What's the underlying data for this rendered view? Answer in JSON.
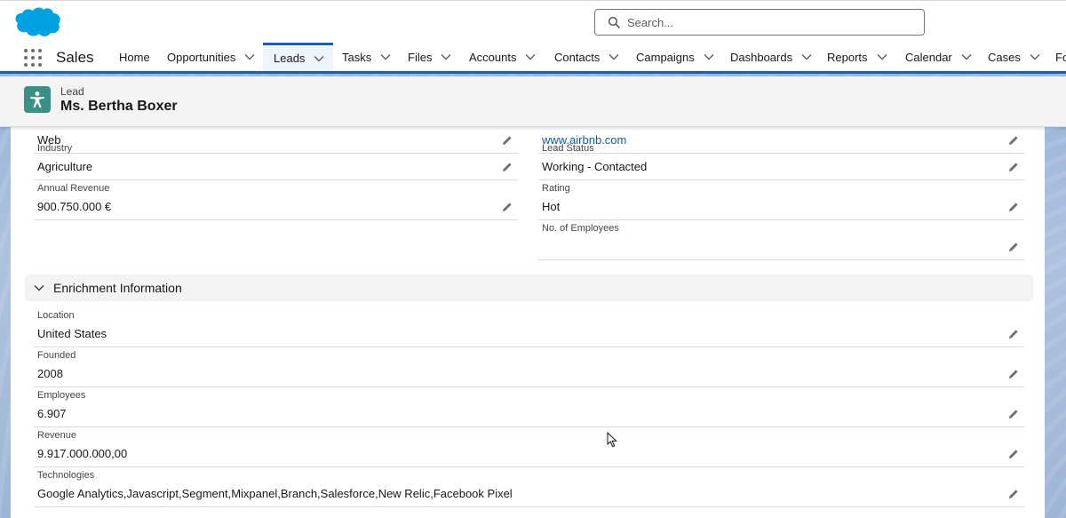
{
  "header": {
    "search_placeholder": "Search..."
  },
  "nav": {
    "app_name": "Sales",
    "items": [
      {
        "label": "Home"
      },
      {
        "label": "Opportunities"
      },
      {
        "label": "Leads"
      },
      {
        "label": "Tasks"
      },
      {
        "label": "Files"
      },
      {
        "label": "Accounts"
      },
      {
        "label": "Contacts"
      },
      {
        "label": "Campaigns"
      },
      {
        "label": "Dashboards"
      },
      {
        "label": "Reports"
      },
      {
        "label": "Calendar"
      },
      {
        "label": "Cases"
      },
      {
        "label": "Fo"
      }
    ],
    "active": "Leads"
  },
  "record": {
    "object_label": "Lead",
    "title": "Ms. Bertha Boxer",
    "icon": "lead-icon",
    "icon_color": "#3a8f87"
  },
  "details": {
    "left": [
      {
        "label": "",
        "value": "Web"
      },
      {
        "label": "Industry",
        "value": "Agriculture"
      },
      {
        "label": "Annual Revenue",
        "value": "900.750.000 €"
      }
    ],
    "right": [
      {
        "label": "",
        "value": "www.airbnb.com"
      },
      {
        "label": "Lead Status",
        "value": "Working - Contacted"
      },
      {
        "label": "Rating",
        "value": "Hot"
      },
      {
        "label": "No. of Employees",
        "value": ""
      }
    ]
  },
  "enrichment": {
    "title": "Enrichment Information",
    "fields": [
      {
        "label": "Location",
        "value": "United States"
      },
      {
        "label": "Founded",
        "value": "2008"
      },
      {
        "label": "Employees",
        "value": "6.907"
      },
      {
        "label": "Revenue",
        "value": "9.917.000.000,00"
      },
      {
        "label": "Technologies",
        "value": "Google Analytics,Javascript,Segment,Mixpanel,Branch,Salesforce,New Relic,Facebook Pixel"
      }
    ]
  },
  "colors": {
    "brand_blue": "#1b5fb0",
    "link": "#0b5cab",
    "salesforce_cloud": "#00a1e0"
  }
}
